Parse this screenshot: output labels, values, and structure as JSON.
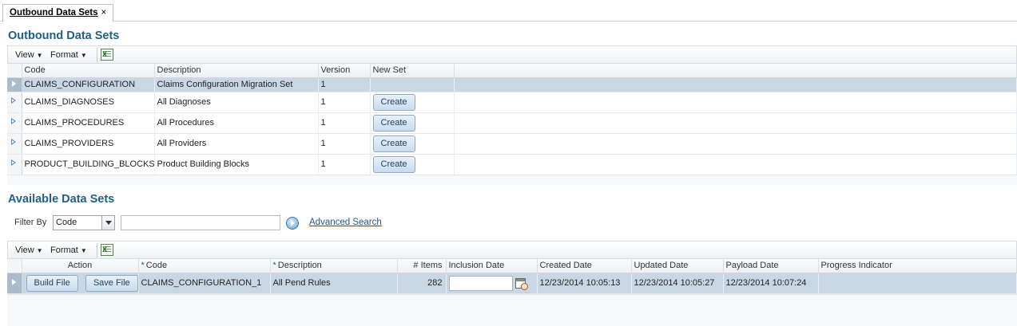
{
  "tab": {
    "label": "Outbound Data Sets",
    "close": "×"
  },
  "outbound": {
    "title": "Outbound Data Sets",
    "toolbar": {
      "view": "View",
      "format": "Format"
    },
    "columns": {
      "code": "Code",
      "description": "Description",
      "version": "Version",
      "new_set": "New Set"
    },
    "rows": [
      {
        "code": "CLAIMS_CONFIGURATION",
        "description": "Claims Configuration Migration Set",
        "version": "1",
        "action": ""
      },
      {
        "code": "CLAIMS_DIAGNOSES",
        "description": "All Diagnoses",
        "version": "1",
        "action": "Create"
      },
      {
        "code": "CLAIMS_PROCEDURES",
        "description": "All Procedures",
        "version": "1",
        "action": "Create"
      },
      {
        "code": "CLAIMS_PROVIDERS",
        "description": "All Providers",
        "version": "1",
        "action": "Create"
      },
      {
        "code": "PRODUCT_BUILDING_BLOCKS",
        "description": "Product Building Blocks",
        "version": "1",
        "action": "Create"
      }
    ]
  },
  "available": {
    "title": "Available Data Sets",
    "filter": {
      "label": "Filter By",
      "selected": "Code",
      "value": "",
      "advanced": "Advanced Search"
    },
    "toolbar": {
      "view": "View",
      "format": "Format"
    },
    "columns": {
      "action": "Action",
      "code": "Code",
      "description": "Description",
      "items": "# Items",
      "inclusion_date": "Inclusion Date",
      "created_date": "Created Date",
      "updated_date": "Updated Date",
      "payload_date": "Payload Date",
      "progress": "Progress Indicator"
    },
    "required_marker": "*",
    "rows": [
      {
        "build_label": "Build File",
        "save_label": "Save File",
        "code": "CLAIMS_CONFIGURATION_1",
        "description": "All Pend Rules",
        "items": "282",
        "inclusion_date": "",
        "created_date": "12/23/2014 10:05:13",
        "updated_date": "12/23/2014 10:05:27",
        "payload_date": "12/23/2014 10:07:24",
        "progress": ""
      }
    ]
  }
}
